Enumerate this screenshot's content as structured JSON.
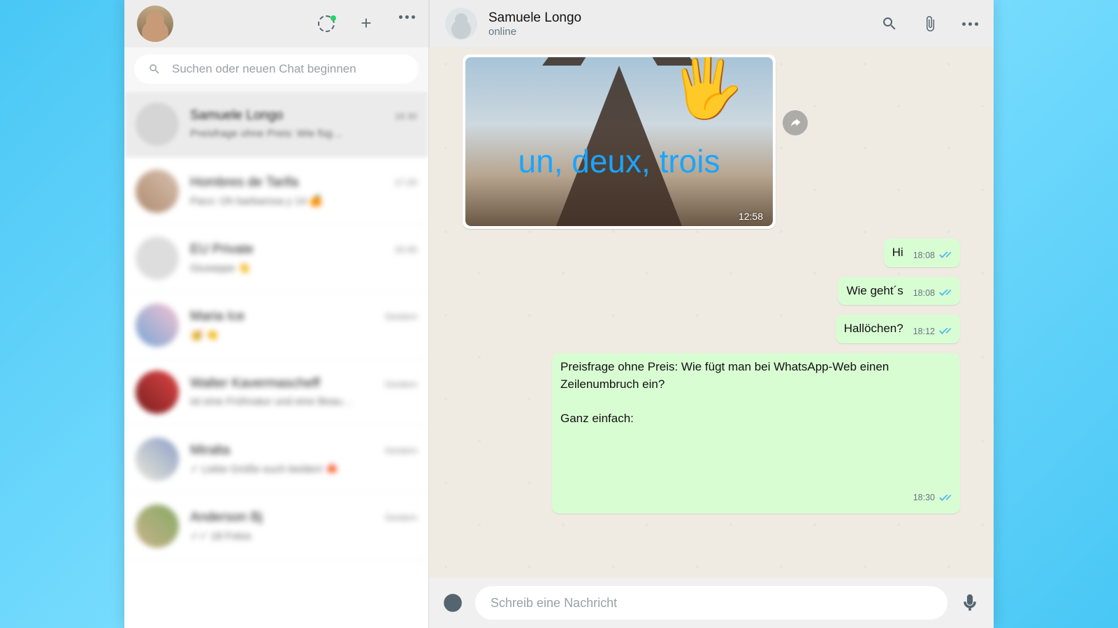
{
  "sidebar": {
    "search_placeholder": "Suchen oder neuen Chat beginnen",
    "chats": [
      {
        "name": "Samuele Longo",
        "preview": "Preisfrage ohne Preis: Wie füg…",
        "time": "18:30"
      },
      {
        "name": "Hombres de Tarifa",
        "preview": "Paco: Oh barbarosa y 14 🍊",
        "time": "17:25"
      },
      {
        "name": "EU Private",
        "preview": "Giuseppe 👋",
        "time": "16:40"
      },
      {
        "name": "Maria Ice",
        "preview": "🥳 👏",
        "time": "Gestern"
      },
      {
        "name": "Walter Kavermascheff",
        "preview": "ist eine Frühnatur und eine Beau…",
        "time": "Gestern"
      },
      {
        "name": "Miralta",
        "preview": "✓ Liebe Grüße euch beiden! 🍁",
        "time": "Gestern"
      },
      {
        "name": "Anderson Bj",
        "preview": "✓✓ 18 Fotos",
        "time": "Gestern"
      }
    ]
  },
  "chat": {
    "contact_name": "Samuele Longo",
    "status": "online",
    "media": {
      "caption": "un, deux, trois",
      "emoji": "🖐",
      "time": "12:58"
    },
    "messages": [
      {
        "text": "Hi",
        "time": "18:08"
      },
      {
        "text": "Wie geht´s",
        "time": "18:08"
      },
      {
        "text": "Hallöchen?",
        "time": "18:12"
      }
    ],
    "long_message": {
      "line1": "Preisfrage ohne Preis: Wie fügt man bei WhatsApp-Web einen Zeilenumbruch ein?",
      "line2": "Ganz einfach:",
      "time": "18:30"
    },
    "input_placeholder": "Schreib eine Nachricht"
  }
}
